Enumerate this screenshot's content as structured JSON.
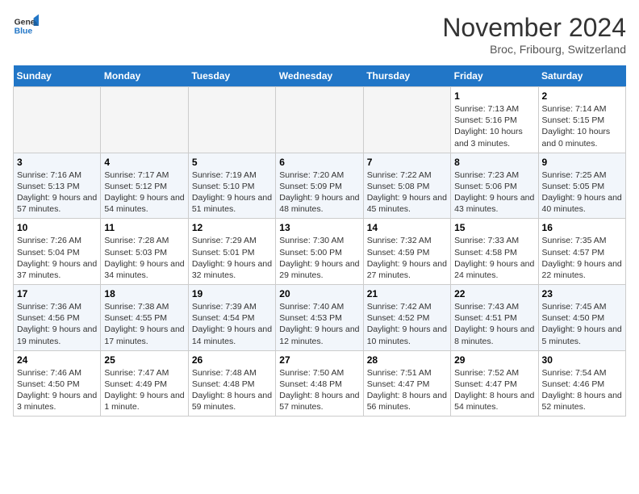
{
  "logo": {
    "general": "General",
    "blue": "Blue"
  },
  "header": {
    "month": "November 2024",
    "location": "Broc, Fribourg, Switzerland"
  },
  "weekdays": [
    "Sunday",
    "Monday",
    "Tuesday",
    "Wednesday",
    "Thursday",
    "Friday",
    "Saturday"
  ],
  "weeks": [
    [
      {
        "day": "",
        "info": ""
      },
      {
        "day": "",
        "info": ""
      },
      {
        "day": "",
        "info": ""
      },
      {
        "day": "",
        "info": ""
      },
      {
        "day": "",
        "info": ""
      },
      {
        "day": "1",
        "info": "Sunrise: 7:13 AM\nSunset: 5:16 PM\nDaylight: 10 hours and 3 minutes."
      },
      {
        "day": "2",
        "info": "Sunrise: 7:14 AM\nSunset: 5:15 PM\nDaylight: 10 hours and 0 minutes."
      }
    ],
    [
      {
        "day": "3",
        "info": "Sunrise: 7:16 AM\nSunset: 5:13 PM\nDaylight: 9 hours and 57 minutes."
      },
      {
        "day": "4",
        "info": "Sunrise: 7:17 AM\nSunset: 5:12 PM\nDaylight: 9 hours and 54 minutes."
      },
      {
        "day": "5",
        "info": "Sunrise: 7:19 AM\nSunset: 5:10 PM\nDaylight: 9 hours and 51 minutes."
      },
      {
        "day": "6",
        "info": "Sunrise: 7:20 AM\nSunset: 5:09 PM\nDaylight: 9 hours and 48 minutes."
      },
      {
        "day": "7",
        "info": "Sunrise: 7:22 AM\nSunset: 5:08 PM\nDaylight: 9 hours and 45 minutes."
      },
      {
        "day": "8",
        "info": "Sunrise: 7:23 AM\nSunset: 5:06 PM\nDaylight: 9 hours and 43 minutes."
      },
      {
        "day": "9",
        "info": "Sunrise: 7:25 AM\nSunset: 5:05 PM\nDaylight: 9 hours and 40 minutes."
      }
    ],
    [
      {
        "day": "10",
        "info": "Sunrise: 7:26 AM\nSunset: 5:04 PM\nDaylight: 9 hours and 37 minutes."
      },
      {
        "day": "11",
        "info": "Sunrise: 7:28 AM\nSunset: 5:03 PM\nDaylight: 9 hours and 34 minutes."
      },
      {
        "day": "12",
        "info": "Sunrise: 7:29 AM\nSunset: 5:01 PM\nDaylight: 9 hours and 32 minutes."
      },
      {
        "day": "13",
        "info": "Sunrise: 7:30 AM\nSunset: 5:00 PM\nDaylight: 9 hours and 29 minutes."
      },
      {
        "day": "14",
        "info": "Sunrise: 7:32 AM\nSunset: 4:59 PM\nDaylight: 9 hours and 27 minutes."
      },
      {
        "day": "15",
        "info": "Sunrise: 7:33 AM\nSunset: 4:58 PM\nDaylight: 9 hours and 24 minutes."
      },
      {
        "day": "16",
        "info": "Sunrise: 7:35 AM\nSunset: 4:57 PM\nDaylight: 9 hours and 22 minutes."
      }
    ],
    [
      {
        "day": "17",
        "info": "Sunrise: 7:36 AM\nSunset: 4:56 PM\nDaylight: 9 hours and 19 minutes."
      },
      {
        "day": "18",
        "info": "Sunrise: 7:38 AM\nSunset: 4:55 PM\nDaylight: 9 hours and 17 minutes."
      },
      {
        "day": "19",
        "info": "Sunrise: 7:39 AM\nSunset: 4:54 PM\nDaylight: 9 hours and 14 minutes."
      },
      {
        "day": "20",
        "info": "Sunrise: 7:40 AM\nSunset: 4:53 PM\nDaylight: 9 hours and 12 minutes."
      },
      {
        "day": "21",
        "info": "Sunrise: 7:42 AM\nSunset: 4:52 PM\nDaylight: 9 hours and 10 minutes."
      },
      {
        "day": "22",
        "info": "Sunrise: 7:43 AM\nSunset: 4:51 PM\nDaylight: 9 hours and 8 minutes."
      },
      {
        "day": "23",
        "info": "Sunrise: 7:45 AM\nSunset: 4:50 PM\nDaylight: 9 hours and 5 minutes."
      }
    ],
    [
      {
        "day": "24",
        "info": "Sunrise: 7:46 AM\nSunset: 4:50 PM\nDaylight: 9 hours and 3 minutes."
      },
      {
        "day": "25",
        "info": "Sunrise: 7:47 AM\nSunset: 4:49 PM\nDaylight: 9 hours and 1 minute."
      },
      {
        "day": "26",
        "info": "Sunrise: 7:48 AM\nSunset: 4:48 PM\nDaylight: 8 hours and 59 minutes."
      },
      {
        "day": "27",
        "info": "Sunrise: 7:50 AM\nSunset: 4:48 PM\nDaylight: 8 hours and 57 minutes."
      },
      {
        "day": "28",
        "info": "Sunrise: 7:51 AM\nSunset: 4:47 PM\nDaylight: 8 hours and 56 minutes."
      },
      {
        "day": "29",
        "info": "Sunrise: 7:52 AM\nSunset: 4:47 PM\nDaylight: 8 hours and 54 minutes."
      },
      {
        "day": "30",
        "info": "Sunrise: 7:54 AM\nSunset: 4:46 PM\nDaylight: 8 hours and 52 minutes."
      }
    ]
  ]
}
